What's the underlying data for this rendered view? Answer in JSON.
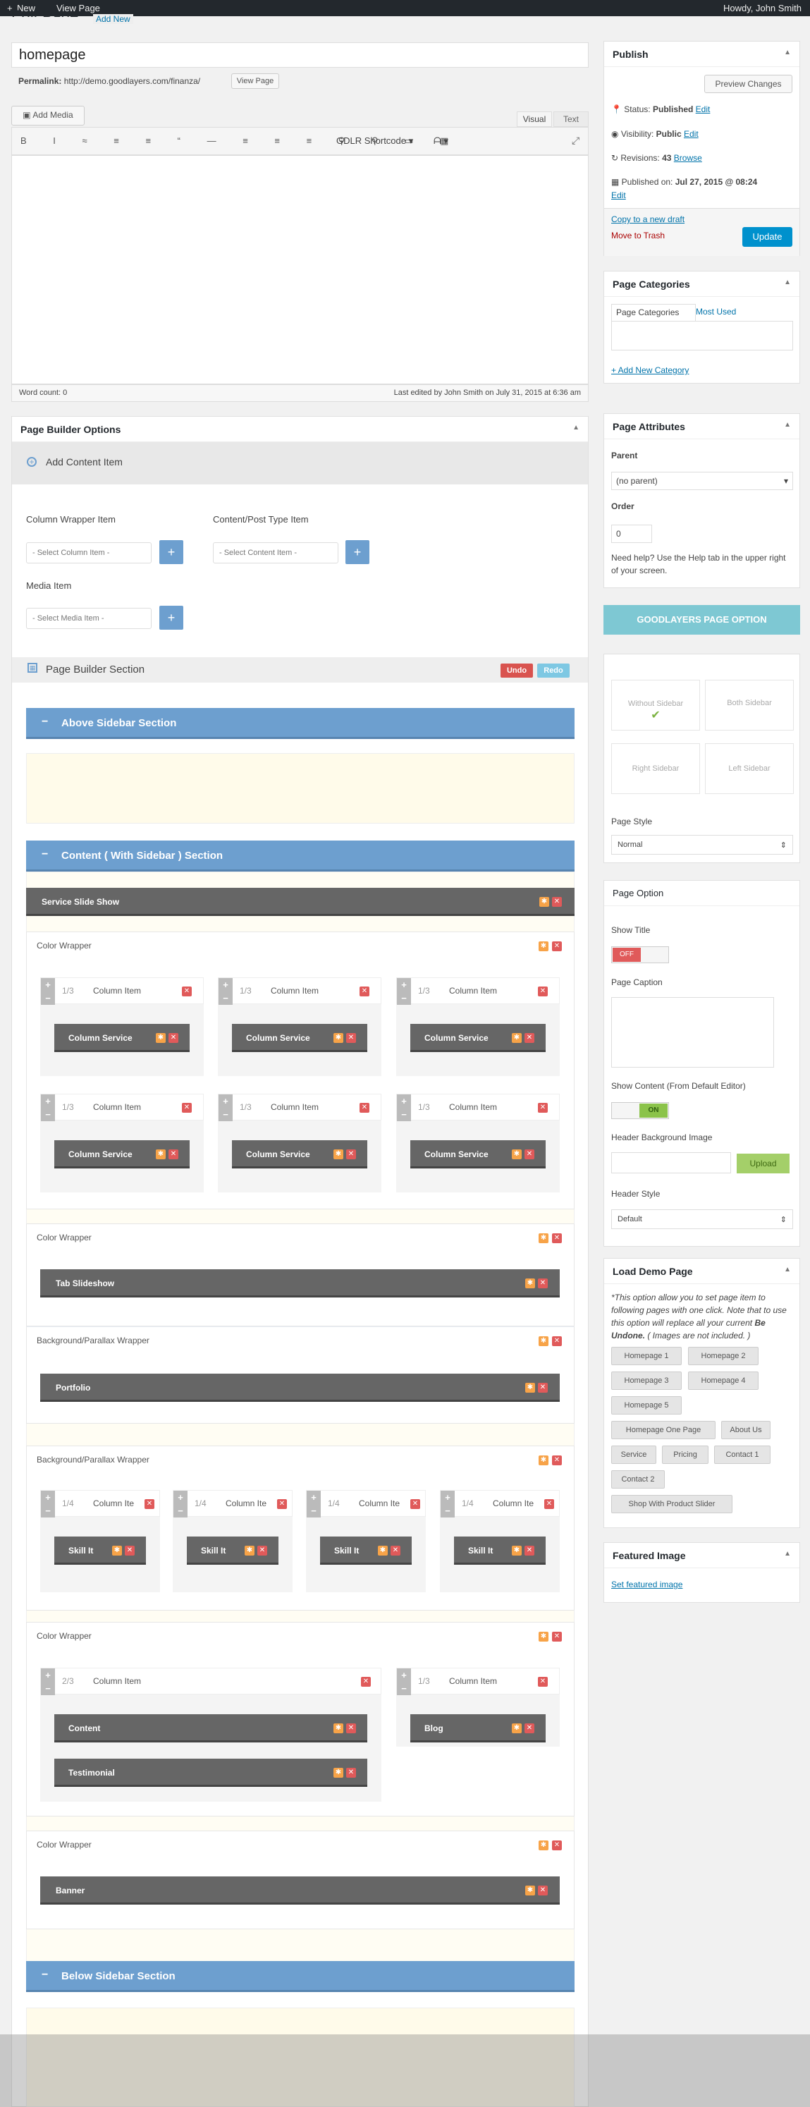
{
  "adminbar": {
    "new": "New",
    "view_page": "View Page",
    "howdy": "Howdy, John Smith"
  },
  "header": {
    "title": "Edit Page",
    "add_new": "Add New"
  },
  "editor": {
    "title_value": "homepage",
    "permalink_label": "Permalink:",
    "permalink_url": "http://demo.goodlayers.com/finanza/",
    "view_page_btn": "View Page",
    "add_media": "Add Media",
    "tab_visual": "Visual",
    "tab_text": "Text",
    "shortcode": "GDLR Shortcode",
    "word_count": "Word count: 0",
    "last_edited": "Last edited by John Smith on July 31, 2015 at 6:36 am"
  },
  "publish": {
    "title": "Publish",
    "preview": "Preview Changes",
    "status_label": "Status:",
    "status_value": "Published",
    "edit": "Edit",
    "visibility_label": "Visibility:",
    "visibility_value": "Public",
    "revisions_label": "Revisions:",
    "revisions_value": "43",
    "browse": "Browse",
    "published_label": "Published on:",
    "published_value": "Jul 27, 2015 @ 08:24",
    "copy_draft": "Copy to a new draft",
    "trash": "Move to Trash",
    "update": "Update"
  },
  "categories": {
    "title": "Page Categories",
    "tab_all": "Page Categories",
    "tab_used": "Most Used",
    "add_new": "+ Add New Category"
  },
  "attributes": {
    "title": "Page Attributes",
    "parent_label": "Parent",
    "parent_value": "(no parent)",
    "order_label": "Order",
    "order_value": "0",
    "help": "Need help? Use the Help tab in the upper right of your screen."
  },
  "goodlayers": {
    "title": "GOODLAYERS PAGE OPTION",
    "without_sidebar": "Without Sidebar",
    "both_sidebar": "Both Sidebar",
    "right_sidebar": "Right Sidebar",
    "left_sidebar": "Left Sidebar",
    "page_style_label": "Page Style",
    "page_style_value": "Normal"
  },
  "page_option": {
    "title": "Page Option",
    "show_title": "Show Title",
    "off": "OFF",
    "page_caption": "Page Caption",
    "show_content": "Show Content (From Default Editor)",
    "on": "ON",
    "header_bg": "Header Background Image",
    "upload": "Upload",
    "header_style": "Header Style",
    "header_style_value": "Default"
  },
  "demo": {
    "title": "Load Demo Page",
    "note1": "*This option allow you to set page item to following pages with one click. Note that to use this option will replace all your current",
    "note_bold": "Be Undone.",
    "note2": "( Images are not included. )",
    "buttons": [
      "Homepage 1",
      "Homepage 2",
      "Homepage 3",
      "Homepage 4",
      "Homepage 5",
      "Homepage One Page",
      "About Us",
      "Service",
      "Pricing",
      "Contact 1",
      "Contact 2",
      "Shop With Product Slider"
    ]
  },
  "featured": {
    "title": "Featured Image",
    "link": "Set featured image"
  },
  "builder": {
    "title": "Page Builder Options",
    "add_content": "Add Content Item",
    "column_wrapper_label": "Column Wrapper Item",
    "content_label": "Content/Post Type Item",
    "media_label": "Media Item",
    "select_column": "- Select Column Item -",
    "select_content": "- Select Content Item -",
    "select_media": "- Select Media Item -",
    "section_label": "Page Builder Section",
    "undo": "Undo",
    "redo": "Redo",
    "above": "Above Sidebar Section",
    "content_section": "Content ( With Sidebar ) Section",
    "below": "Below Sidebar Section",
    "service_slide": "Service Slide Show",
    "color_wrapper": "Color Wrapper",
    "bg_wrapper": "Background/Parallax Wrapper",
    "column_item": "Column Item",
    "column_item_short": "Column Ite",
    "column_service": "Column Service",
    "skill": "Skill It",
    "tab_slideshow": "Tab Slideshow",
    "portfolio": "Portfolio",
    "content": "Content",
    "testimonial": "Testimonial",
    "blog": "Blog",
    "banner": "Banner",
    "f13": "1/3",
    "f14": "1/4",
    "f23": "2/3"
  }
}
